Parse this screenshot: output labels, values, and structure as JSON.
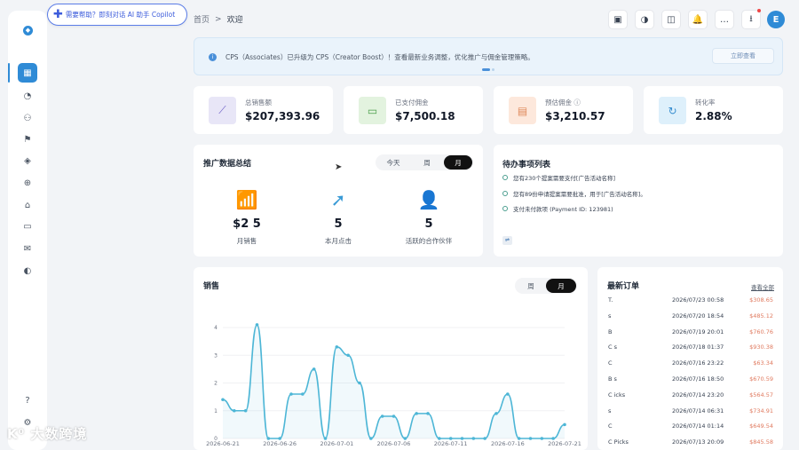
{
  "sidebar": {
    "logo": "◆",
    "items": [
      {
        "name": "dashboard",
        "glyph": "▦",
        "active": true
      },
      {
        "name": "reports",
        "glyph": "◔",
        "active": false
      },
      {
        "name": "partners",
        "glyph": "⚇",
        "active": false
      },
      {
        "name": "campaigns",
        "glyph": "⚑",
        "active": false
      },
      {
        "name": "layers",
        "glyph": "◈",
        "active": false
      },
      {
        "name": "global",
        "glyph": "⊕",
        "active": false
      },
      {
        "name": "gift",
        "glyph": "⌂",
        "active": false
      },
      {
        "name": "messages",
        "glyph": "▭",
        "active": false
      },
      {
        "name": "mail",
        "glyph": "✉",
        "active": false
      },
      {
        "name": "wallet",
        "glyph": "◐",
        "active": false
      }
    ],
    "help_glyph": "?",
    "settings_glyph": "⚙"
  },
  "help_pill": {
    "text": "需要帮助？即刻对话 AI 助手 Copilot"
  },
  "breadcrumb": {
    "home": "首页",
    "sep": ">",
    "current": "欢迎"
  },
  "topbar": {
    "icons": [
      {
        "name": "qr-icon",
        "glyph": "▣"
      },
      {
        "name": "theme-icon",
        "glyph": "◑"
      },
      {
        "name": "layout-icon",
        "glyph": "◫"
      },
      {
        "name": "bell-icon",
        "glyph": "🔔"
      },
      {
        "name": "chat-icon",
        "glyph": "…"
      },
      {
        "name": "download-icon",
        "glyph": "⭳"
      }
    ],
    "avatar_letter": "E"
  },
  "banner": {
    "message": "CPS（Associates）已升级为 CPS（Creator Boost）！查看最新业务调整，优化推广与佣金管理策略。",
    "button": "立即查看"
  },
  "stats": [
    {
      "label": "总销售额",
      "value": "$207,393.96",
      "glyph": "⟋",
      "bg": "#e8e6f7",
      "fg": "#6d5fc7"
    },
    {
      "label": "已支付佣金",
      "value": "$7,500.18",
      "glyph": "▭",
      "bg": "#e3f3df",
      "fg": "#4a9e4a"
    },
    {
      "label": "预估佣金 ⓘ",
      "value": "$3,210.57",
      "glyph": "▤",
      "bg": "#fde8dc",
      "fg": "#e08a5c"
    },
    {
      "label": "转化率",
      "value": "2.88%",
      "glyph": "↻",
      "bg": "#def0fb",
      "fg": "#3a8fd0"
    }
  ],
  "promo": {
    "title": "推广数据总结",
    "tabs": [
      "今天",
      "周",
      "月"
    ],
    "metrics": [
      {
        "value": "$2  5",
        "caption": "月销售",
        "glyph": "📶"
      },
      {
        "value": "5",
        "caption": "本月点击",
        "glyph": "➚"
      },
      {
        "value": "5",
        "caption": "活跃的合作伙伴",
        "glyph": "👤"
      }
    ]
  },
  "todo": {
    "title": "待办事项列表",
    "items": [
      "您有230个提案需要支付[广告活动名称]",
      "您有89份申请提案需要批准，用于[广告活动名称]。",
      "支付未付款项 (Payment ID: 123981)"
    ],
    "footer_glyph": "⇌"
  },
  "sales": {
    "title": "销售",
    "tabs": [
      "周",
      "月"
    ]
  },
  "orders": {
    "title": "最新订单",
    "view_all": "查看全部",
    "rows": [
      {
        "name": "T.",
        "date": "2026/07/23 00:58",
        "amount": "$308.65"
      },
      {
        "name": "s",
        "date": "2026/07/20 18:54",
        "amount": "$485.12"
      },
      {
        "name": "B",
        "date": "2026/07/19 20:01",
        "amount": "$760.76"
      },
      {
        "name": "C            s",
        "date": "2026/07/18 01:37",
        "amount": "$930.38"
      },
      {
        "name": "C",
        "date": "2026/07/16 23:22",
        "amount": "$63.34"
      },
      {
        "name": "B           s",
        "date": "2026/07/16 18:50",
        "amount": "$670.59"
      },
      {
        "name": "C           icks",
        "date": "2026/07/14 23:20",
        "amount": "$564.57"
      },
      {
        "name": "s",
        "date": "2026/07/14 06:31",
        "amount": "$734.91"
      },
      {
        "name": "C",
        "date": "2026/07/14 01:14",
        "amount": "$649.54"
      },
      {
        "name": "C        Picks",
        "date": "2026/07/13 20:09",
        "amount": "$845.58"
      }
    ]
  },
  "chart_data": {
    "type": "line",
    "title": "销售",
    "x": [
      "2026-06-21",
      "2026-06-22",
      "2026-06-23",
      "2026-06-24",
      "2026-06-25",
      "2026-06-26",
      "2026-06-27",
      "2026-06-28",
      "2026-06-29",
      "2026-06-30",
      "2026-07-01",
      "2026-07-02",
      "2026-07-03",
      "2026-07-04",
      "2026-07-05",
      "2026-07-06",
      "2026-07-07",
      "2026-07-08",
      "2026-07-09",
      "2026-07-10",
      "2026-07-11",
      "2026-07-12",
      "2026-07-13",
      "2026-07-14",
      "2026-07-15",
      "2026-07-16",
      "2026-07-17",
      "2026-07-18",
      "2026-07-19",
      "2026-07-20",
      "2026-07-21"
    ],
    "xticks": [
      "2026-06-21",
      "2026-06-26",
      "2026-07-01",
      "2026-07-06",
      "2026-07-11",
      "2026-07-16",
      "2026-07-21"
    ],
    "values": [
      1.4,
      1.0,
      1.0,
      4.1,
      0.0,
      0.0,
      1.6,
      1.6,
      2.5,
      0.0,
      3.3,
      3.0,
      2.0,
      0.0,
      0.8,
      0.8,
      0.0,
      0.9,
      0.9,
      0.0,
      0.0,
      0.0,
      0.0,
      0.0,
      0.9,
      1.6,
      0.0,
      0.0,
      0.0,
      0.0,
      0.5
    ],
    "ylim": [
      0,
      4
    ],
    "color": "#4db6d6"
  }
}
